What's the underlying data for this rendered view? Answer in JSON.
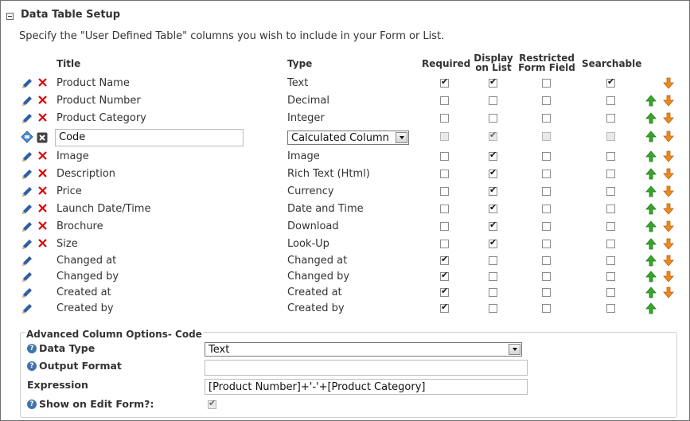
{
  "section": {
    "title": "Data Table Setup",
    "description": "Specify the \"User Defined Table\" columns you wish to include in your Form or List."
  },
  "headers": {
    "title": "Title",
    "type": "Type",
    "required": "Required",
    "display_l1": "Display",
    "display_l2": "on List",
    "restricted_l1": "Restricted",
    "restricted_l2": "Form Field",
    "searchable": "Searchable"
  },
  "rows": [
    {
      "title": "Product Name",
      "type": "Text",
      "required": true,
      "display": true,
      "restricted": false,
      "searchable": true
    },
    {
      "title": "Product Number",
      "type": "Decimal",
      "required": false,
      "display": false,
      "restricted": false,
      "searchable": false
    },
    {
      "title": "Product Category",
      "type": "Integer",
      "required": false,
      "display": false,
      "restricted": false,
      "searchable": false
    },
    {
      "title": "Code",
      "type": "Calculated Column",
      "required": false,
      "display": true,
      "restricted": false,
      "searchable": false
    },
    {
      "title": "Image",
      "type": "Image",
      "required": false,
      "display": true,
      "restricted": false,
      "searchable": false
    },
    {
      "title": "Description",
      "type": "Rich Text (Html)",
      "required": false,
      "display": true,
      "restricted": false,
      "searchable": false
    },
    {
      "title": "Price",
      "type": "Currency",
      "required": false,
      "display": true,
      "restricted": false,
      "searchable": false
    },
    {
      "title": "Launch Date/Time",
      "type": "Date and Time",
      "required": false,
      "display": true,
      "restricted": false,
      "searchable": false
    },
    {
      "title": "Brochure",
      "type": "Download",
      "required": false,
      "display": true,
      "restricted": false,
      "searchable": false
    },
    {
      "title": "Size",
      "type": "Look-Up",
      "required": false,
      "display": true,
      "restricted": false,
      "searchable": false
    },
    {
      "title": "Changed at",
      "type": "Changed at",
      "required": true,
      "display": false,
      "restricted": false,
      "searchable": false
    },
    {
      "title": "Changed by",
      "type": "Changed by",
      "required": true,
      "display": false,
      "restricted": false,
      "searchable": false
    },
    {
      "title": "Created at",
      "type": "Created at",
      "required": true,
      "display": false,
      "restricted": false,
      "searchable": false
    },
    {
      "title": "Created by",
      "type": "Created by",
      "required": true,
      "display": false,
      "restricted": false,
      "searchable": false
    }
  ],
  "advanced": {
    "title": "Advanced Column Options- Code",
    "data_type_label": "Data Type",
    "data_type_value": "Text",
    "output_format_label": "Output Format",
    "output_format_value": "",
    "expression_label": "Expression",
    "expression_value": "[Product Number]+'-'+[Product Category]",
    "show_on_edit_label": "Show on Edit Form?:",
    "show_on_edit_checked": true
  },
  "colors": {
    "edit_pencil": "#2d5fa8",
    "delete_x": "#dd0000",
    "up_arrow": "#3aa52a",
    "down_arrow": "#f08a1d",
    "help_icon": "#3f74ad"
  }
}
